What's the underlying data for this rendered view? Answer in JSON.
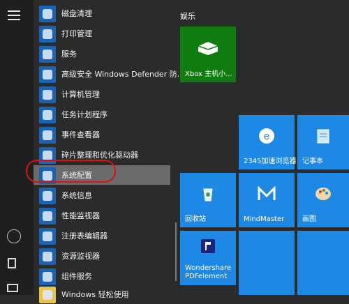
{
  "start_menu": {
    "apps": [
      {
        "label": "磁盘清理",
        "icon": "disk-cleanup-icon"
      },
      {
        "label": "打印管理",
        "icon": "print-management-icon"
      },
      {
        "label": "服务",
        "icon": "services-gear-icon"
      },
      {
        "label": "高级安全 Windows Defender 防...",
        "icon": "firewall-icon"
      },
      {
        "label": "计算机管理",
        "icon": "computer-management-icon"
      },
      {
        "label": "任务计划程序",
        "icon": "clock-icon"
      },
      {
        "label": "事件查看器",
        "icon": "event-viewer-icon"
      },
      {
        "label": "碎片整理和优化驱动器",
        "icon": "defrag-icon"
      },
      {
        "label": "系统配置",
        "icon": "system-config-icon"
      },
      {
        "label": "系统信息",
        "icon": "system-info-icon"
      },
      {
        "label": "性能监视器",
        "icon": "performance-monitor-icon"
      },
      {
        "label": "注册表编辑器",
        "icon": "registry-editor-icon"
      },
      {
        "label": "资源监视器",
        "icon": "resource-monitor-icon"
      },
      {
        "label": "组件服务",
        "icon": "component-services-icon"
      },
      {
        "label": "Windows 轻松使用",
        "icon": "folder-icon"
      }
    ]
  },
  "tiles": {
    "group_label": "娱乐",
    "xbox": "Xbox 主机小...",
    "browser": "2345加速浏览器",
    "notepad": "记事本",
    "recycle_bin": "回收站",
    "mindmaster": "MindMaster",
    "paint": "画图",
    "wondershare": "Wondershare PDFelement"
  }
}
